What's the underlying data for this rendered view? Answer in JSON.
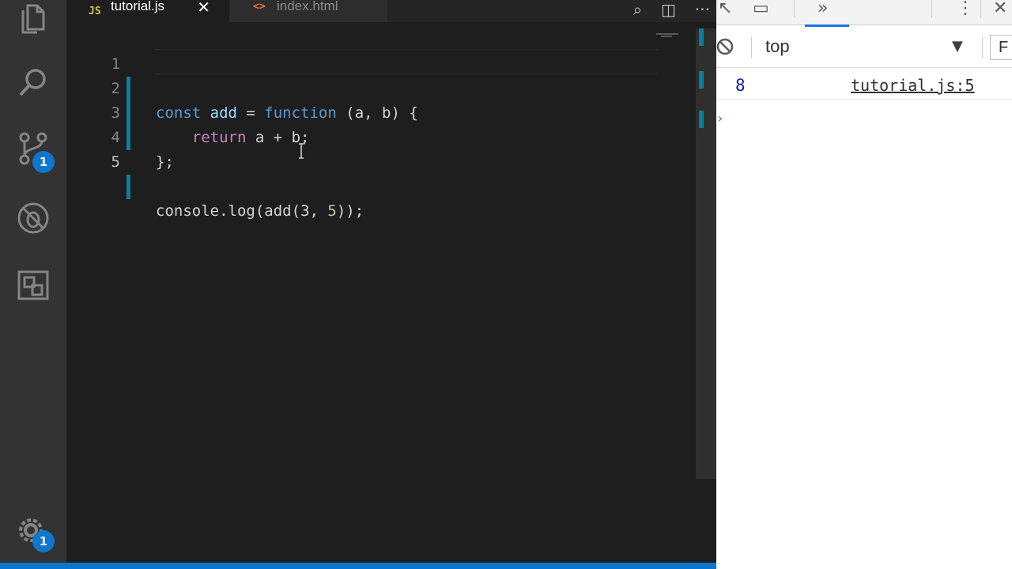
{
  "activity_bar": {
    "scm_badge": "1",
    "settings_badge": "1"
  },
  "tabs": [
    {
      "type_label": "JS",
      "label": "tutorial.js",
      "close": "✕"
    },
    {
      "type_label": "<>",
      "label": "index.html"
    }
  ],
  "code": {
    "line_numbers": [
      "1",
      "2",
      "3",
      "4",
      "5"
    ],
    "line1": {
      "kw": "const",
      "name": " add",
      "op": " = ",
      "fn": "function",
      "rest": " (a, b) {"
    },
    "line2": {
      "indent": "    ",
      "kw": "return",
      "rest": " a + b;"
    },
    "line3": {
      "rest": "};"
    },
    "line5": {
      "rest1": "console.log(",
      "fn": "add",
      "rest2": "(",
      "n1": "3",
      "rest3": ", ",
      "n2": "5",
      "rest4": "));"
    }
  },
  "devtools": {
    "context": "top",
    "filter_placeholder": "F",
    "log_value": "8",
    "log_source": "tutorial.js:5",
    "prompt": "›"
  },
  "colors": {
    "accent": "#0e76cf",
    "keyword": "#569cd6",
    "function": "#dcdcaa",
    "number": "#b5cea8",
    "gutter_modified": "#0c7d9d"
  },
  "icons": [
    "files-icon",
    "search-icon",
    "source-control-icon",
    "debug-icon",
    "extensions-icon",
    "gear-icon",
    "split-editor-icon",
    "more-icon",
    "inspect-icon",
    "device-toggle-icon",
    "chevron-more-icon",
    "close-icon",
    "clear-console-icon"
  ]
}
